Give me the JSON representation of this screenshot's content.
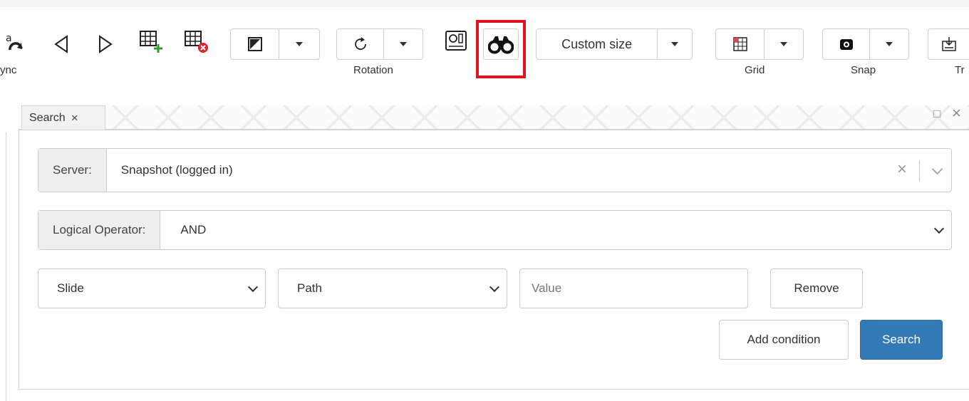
{
  "toolbar": {
    "sync_label": "ync",
    "rotation_label": "Rotation",
    "custom_size_label": "Custom size",
    "grid_label": "Grid",
    "snap_label": "Snap",
    "truncated_label": "Tr"
  },
  "tab": {
    "label": "Search",
    "close": "×"
  },
  "window_controls": {
    "maximize": "□",
    "close": "×"
  },
  "search_form": {
    "server_label": "Server:",
    "server_value": "Snapshot (logged in)",
    "server_clear": "×",
    "operator_label": "Logical Operator:",
    "operator_value": "AND",
    "condition": {
      "field": "Slide",
      "attribute": "Path",
      "value_placeholder": "Value",
      "remove_label": "Remove"
    },
    "add_condition_label": "Add condition",
    "search_label": "Search"
  },
  "colors": {
    "highlight": "#e0141c",
    "primary_button": "#337ab7"
  }
}
